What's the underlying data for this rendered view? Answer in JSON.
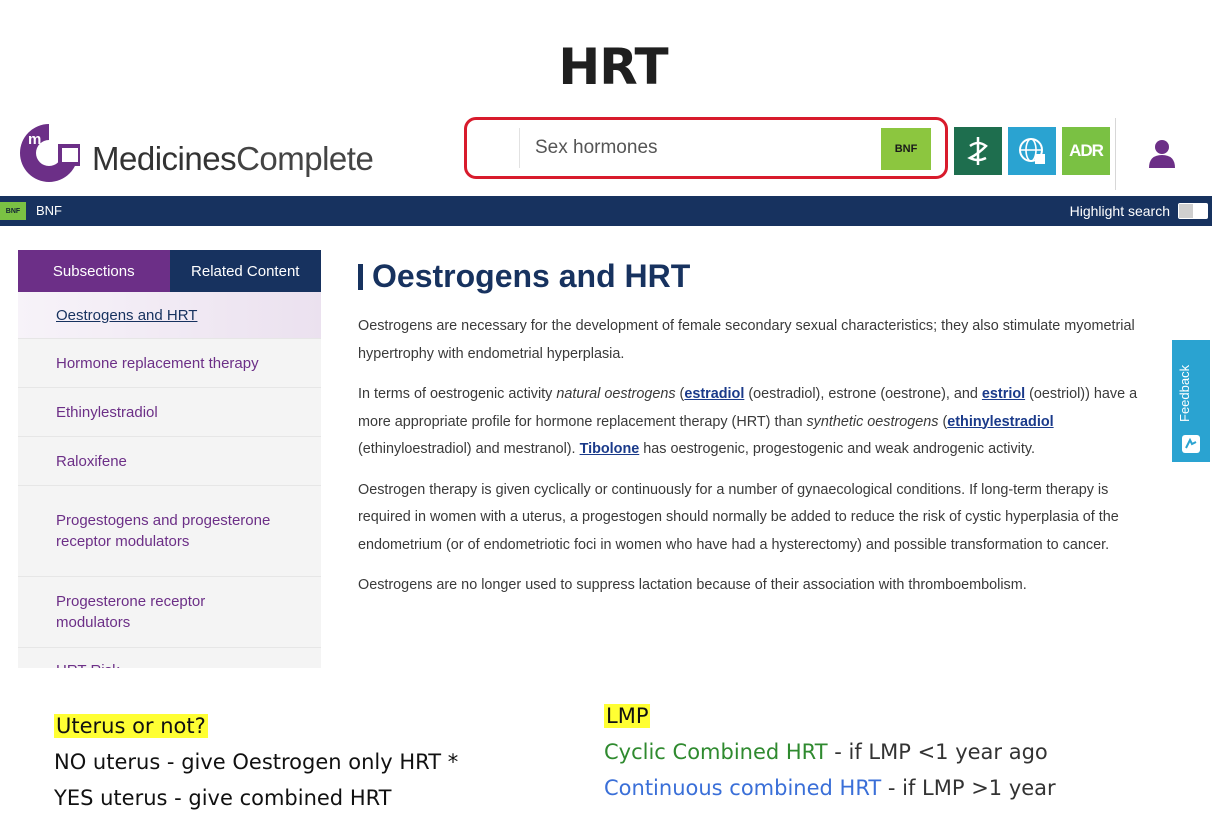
{
  "slide": {
    "title": "HRT"
  },
  "header": {
    "logo_text_bold": "Medicines",
    "logo_text_light": "Complete",
    "search_value": "Sex hormones",
    "search_badge": "BNF",
    "tools": {
      "adr_label": "ADR"
    }
  },
  "navbar": {
    "badge": "BNF",
    "label": "BNF",
    "highlight_label": "Highlight search"
  },
  "sidebar": {
    "tabs": [
      {
        "label": "Subsections"
      },
      {
        "label": "Related Content"
      }
    ],
    "items": [
      {
        "label": "Oestrogens and HRT"
      },
      {
        "label": "Hormone replacement therapy"
      },
      {
        "label": "Ethinylestradiol"
      },
      {
        "label": "Raloxifene"
      },
      {
        "label": "Progestogens and progesterone receptor modulators"
      },
      {
        "label": "Progesterone receptor modulators"
      },
      {
        "label": "HRT Risk"
      }
    ]
  },
  "content": {
    "heading": "Oestrogens and HRT",
    "p1": "Oestrogens are necessary for the development of female secondary sexual characteristics; they also stimulate myometrial hypertrophy with endometrial hyperplasia.",
    "p2": {
      "t1": "In terms of oestrogenic activity ",
      "i1": "natural oestrogens",
      "t2": " (",
      "l1": "estradiol",
      "t3": " (oestradiol), estrone (oestrone), and ",
      "l2": "estriol",
      "t4": " (oestriol)) have a more appropriate profile for hormone replacement therapy (HRT) than ",
      "i2": "synthetic oestrogens",
      "t5": " (",
      "l3": "ethinylestradiol",
      "t6": " (ethinyloestradiol) and mestranol). ",
      "l4": "Tibolone",
      "t7": " has oestrogenic, progestogenic and weak androgenic activity."
    },
    "p3": "Oestrogen therapy is given cyclically or continuously for a number of gynaecological conditions. If long-term therapy is required in women with a uterus, a progestogen should normally be added to reduce the risk of cystic hyperplasia of the endometrium (or of endometriotic foci in women who have had a hysterectomy) and possible transformation to cancer.",
    "p4": "Oestrogens are no longer used to suppress lactation because of their association with thromboembolism."
  },
  "feedback": {
    "label": "Feedback"
  },
  "notes": {
    "left_heading": "Uterus or not?",
    "left_line1": "NO uterus - give Oestrogen only HRT *",
    "left_line2": "YES uterus - give combined HRT",
    "right_heading": "LMP",
    "right_line1_term": "Cyclic Combined HRT",
    "right_line1_rest": " - if LMP <1 year ago",
    "right_line2_term": "Continuous combined HRT",
    "right_line2_rest": " - if LMP >1 year"
  },
  "colors": {
    "brand_purple": "#6c2f87",
    "navy": "#17325f",
    "search_outline": "#d81b2c",
    "bnf_green": "#8cc63f",
    "feedback_blue": "#2aa3d1",
    "highlight_yellow": "#ffff33"
  }
}
